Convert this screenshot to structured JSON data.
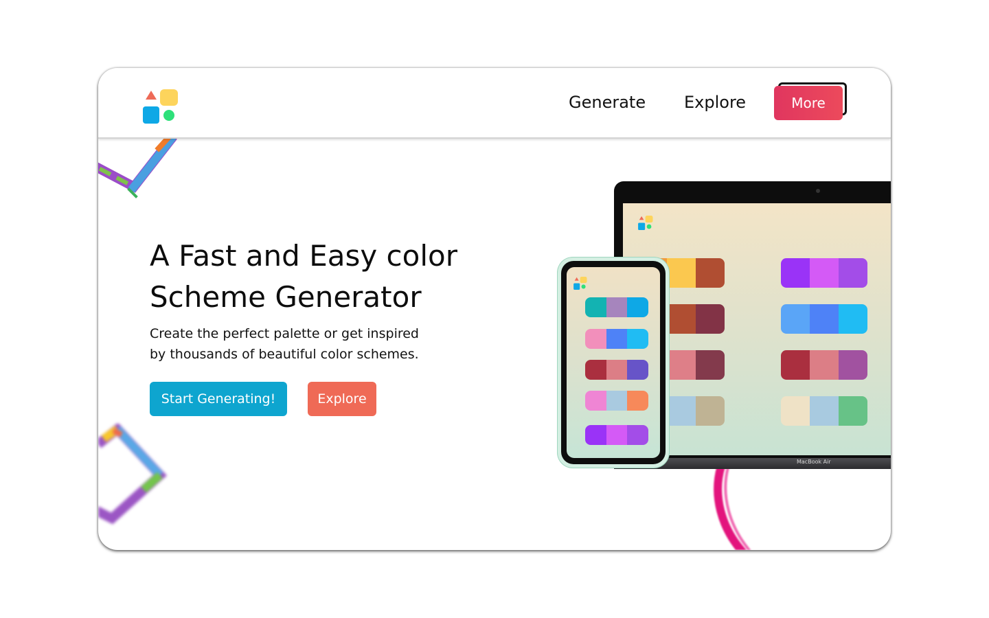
{
  "header": {
    "logo_icon": "shapes-logo-icon",
    "nav": [
      {
        "label": "Generate"
      },
      {
        "label": "Explore"
      }
    ],
    "more_label": "More"
  },
  "hero": {
    "title_line1": "A Fast and Easy color",
    "title_line2": "Scheme Generator",
    "subtitle_line1": "Create the perfect palette or get inspired",
    "subtitle_line2": "by thousands of beautiful color schemes.",
    "primary_button": "Start Generating!",
    "secondary_button": "Explore"
  },
  "mockup": {
    "laptop_brand": "MacBook Air",
    "laptop_palettes": [
      [
        "#f29a3c",
        "#fbc84f",
        "#b04e32"
      ],
      [
        "#9a33f7",
        "#d45af6",
        "#a34de8"
      ],
      [
        "#c64a35",
        "#b04e32",
        "#823346"
      ],
      [
        "#5aa5f7",
        "#4e82f7",
        "#20bcf3"
      ],
      [
        "#e48c90",
        "#de7f88",
        "#833a4c"
      ],
      [
        "#aa2f3f",
        "#dc7e86",
        "#a152a0"
      ],
      [
        "#a9cae0",
        "#a9cae0",
        "#bfb394"
      ],
      [
        "#efe2c6",
        "#a8cae0",
        "#67c287"
      ]
    ],
    "phone_palettes": [
      [
        "#13b3b2",
        "#a685bd",
        "#0ea8e6"
      ],
      [
        "#f28fbb",
        "#4e82f7",
        "#20bcf3"
      ],
      [
        "#aa2f3f",
        "#dc7e86",
        "#6754c8"
      ],
      [
        "#ef85d4",
        "#a9cae0",
        "#f7895a"
      ],
      [
        "#9a33f7",
        "#d45af6",
        "#a34de8"
      ]
    ]
  },
  "colors": {
    "primary": "#0ea5cf",
    "secondary": "#ef6a56",
    "more": "#e0365f"
  }
}
